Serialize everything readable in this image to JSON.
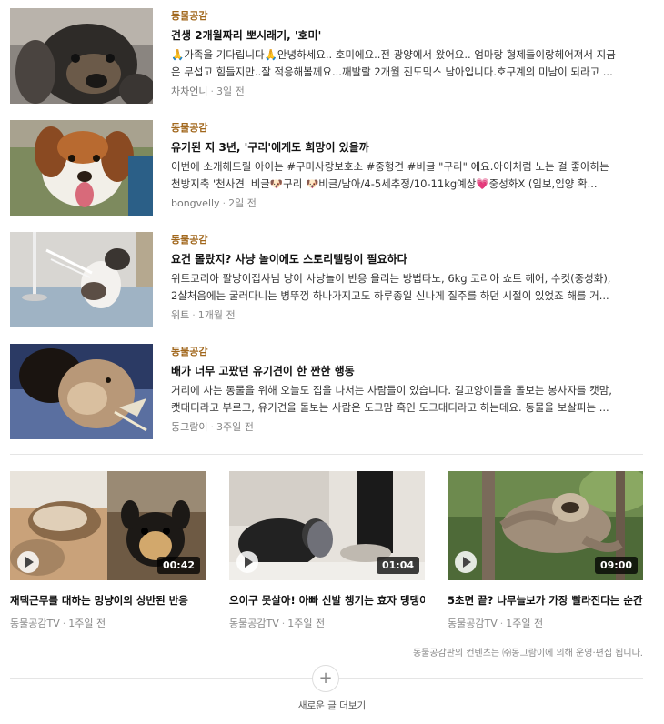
{
  "articles": [
    {
      "category": "동물공감",
      "title": "견생 2개월짜리 뽀시래기, '호미'",
      "description": "🙏가족을 기다립니다🙏안녕하세요.. 호미에요..전 광양에서 왔어요.. 엄마랑 형제들이랑헤어져서 지금은 무섭고 힘들지만..잘 적응해볼께요...깨발랄 2개월 진도믹스 남아입니다.호구계의 미남이 되라고 ...",
      "author": "차차언니",
      "time": "3일 전",
      "thumb_icon": "puppy-photo"
    },
    {
      "category": "동물공감",
      "title": "유기된 지 3년, '구리'에게도 희망이 있을까",
      "description": "이번에 소개해드릴 아이는 #구미사랑보호소 #중형견 #비글 \"구리\" 에요.아이처럼 노는 걸 좋아하는 천방지축 '천사견' 비글🐶구리 🐶비글/남아/4-5세추정/10-11kg예상💗중성화X (임보,입양 확...",
      "author": "bongvelly",
      "time": "2일 전",
      "thumb_icon": "beagle-photo"
    },
    {
      "category": "동물공감",
      "title": "요건 몰랐지? 사냥 놀이에도 스토리텔링이 필요하다",
      "description": "위트코리아 팔냥이집사님 냥이 사냥놀이 반응 올리는 방법타노, 6kg 코리아 쇼트 헤어, 수컷(중성화), 2살처음에는 굴러다니는 병뚜껑 하나가지고도 하루종일 신나게 질주를 하던 시절이 있었죠 해를 거...",
      "author": "위트",
      "time": "1개월 전",
      "thumb_icon": "cat-playing-photo"
    },
    {
      "category": "동물공감",
      "title": "배가 너무 고팠던 유기견이 한 짠한 행동",
      "description": "거리에 사는 동물을 위해 오늘도 집을 나서는 사람들이 있습니다. 길고양이들을 돌보는 봉사자를 캣맘, 캣대디라고 부르고, 유기견을 돌보는 사람은 도그맘 혹인 도그대디라고 하는데요. 동물을 보살피는 ...",
      "author": "동그람이",
      "time": "3주일 전",
      "thumb_icon": "stray-dog-photo"
    }
  ],
  "videos": [
    {
      "title": "재택근무를 대하는 멍냥이의 상반된 반응",
      "author": "동물공감TV",
      "time": "1주일 전",
      "duration": "00:42",
      "thumb_icon": "cat-and-chihuahua-photo"
    },
    {
      "title": "으이구 못살아! 아빠 신발 챙기는 효자 댕댕이",
      "author": "동물공감TV",
      "time": "1주일 전",
      "duration": "01:04",
      "thumb_icon": "dog-with-shoe-photo"
    },
    {
      "title": "5초면 끝? 나무늘보가 가장 빨라진다는 순간",
      "author": "동물공감TV",
      "time": "1주일 전",
      "duration": "09:00",
      "thumb_icon": "sloth-photo"
    }
  ],
  "footer_note": "동물공감판의 컨텐츠는 ㈜동그람이에 의해 운영·편집 됩니다.",
  "more": {
    "icon": "plus-icon",
    "label": "새로운 글 더보기"
  },
  "colors": {
    "category": "#a1671c",
    "meta": "#888888",
    "divider": "#e5e5e5"
  }
}
